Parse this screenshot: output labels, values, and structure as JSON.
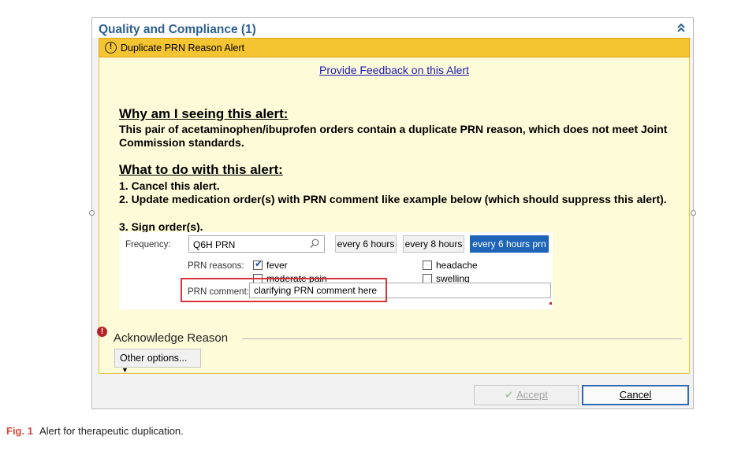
{
  "header": {
    "title": "Quality and Compliance (1)",
    "collapse_icon": "double-chevron-up-icon"
  },
  "alert": {
    "title": "Duplicate PRN Reason Alert",
    "icon": "exclamation-circle-icon",
    "feedback_link": "Provide Feedback on this Alert",
    "why_heading": "Why am I seeing this alert:",
    "why_text": "This pair of acetaminophen/ibuprofen orders contain a duplicate PRN reason, which does not meet Joint Commission standards.",
    "what_heading": "What to do with this alert:",
    "steps": [
      "1.  Cancel this alert.",
      "2.  Update medication order(s) with PRN comment like example below (which should suppress this alert).",
      "3.  Sign order(s)."
    ]
  },
  "order_example": {
    "frequency_label": "Frequency:",
    "frequency_value": "Q6H PRN",
    "frequency_buttons": [
      "every 6 hours",
      "every 8 hours",
      "every 6 hours prn"
    ],
    "selected_frequency": "every 6 hours prn",
    "prn_reasons_label": "PRN reasons:",
    "reasons": [
      {
        "label": "fever",
        "checked": true
      },
      {
        "label": "moderate pain",
        "checked": false
      },
      {
        "label": "headache",
        "checked": false
      },
      {
        "label": "swelling",
        "checked": false
      }
    ],
    "prn_comment_label": "PRN comment:",
    "prn_comment_value": "clarifying PRN comment here"
  },
  "acknowledge": {
    "label": "Acknowledge Reason",
    "other_options": "Other options..."
  },
  "footer": {
    "accept": "Accept",
    "cancel": "Cancel"
  },
  "caption": {
    "label": "Fig. 1",
    "text": "Alert for therapeutic duplication."
  },
  "colors": {
    "title_blue": "#2d6094",
    "alert_yellow": "#f5c431",
    "alert_body": "#fefbd8",
    "selected_blue": "#1e64b8",
    "highlight_red": "#d9333a"
  }
}
